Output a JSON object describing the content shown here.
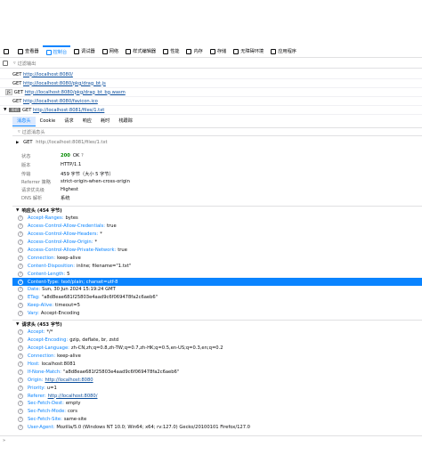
{
  "toolbar": {
    "items": [
      {
        "label": "查看器",
        "icon": "inspector-icon"
      },
      {
        "label": "控制台",
        "icon": "console-icon"
      },
      {
        "label": "调试器",
        "icon": "debugger-icon"
      },
      {
        "label": "网络",
        "icon": "network-icon"
      },
      {
        "label": "样式编辑器",
        "icon": "style-editor-icon"
      },
      {
        "label": "性能",
        "icon": "performance-icon"
      },
      {
        "label": "内存",
        "icon": "memory-icon"
      },
      {
        "label": "存储",
        "icon": "storage-icon"
      },
      {
        "label": "无障碍环境",
        "icon": "accessibility-icon"
      },
      {
        "label": "应用程序",
        "icon": "application-icon"
      }
    ],
    "active_index": 1
  },
  "console_filter": {
    "placeholder": "过滤输出"
  },
  "requests": [
    {
      "method": "GET",
      "url": "http://localhost:8080/",
      "badge": ""
    },
    {
      "method": "GET",
      "url": "http://localhost:8080/pkg/drag_bt.js",
      "badge": ""
    },
    {
      "method": "GET",
      "url": "http://localhost:8080/pkg/drag_bt_bg.wasm",
      "badge": "JS"
    },
    {
      "method": "GET",
      "url": "http://localhost:8080/favicon.ico",
      "badge": ""
    },
    {
      "method": "GET",
      "url": "http://localhost:8081/files/1.txt",
      "badge": "XHR"
    }
  ],
  "detail_tabs": [
    "消息头",
    "Cookie",
    "请求",
    "响应",
    "耗时",
    "栈跟踪"
  ],
  "detail_filter": {
    "placeholder": "过滤消息头"
  },
  "summary": {
    "method": "GET",
    "url": "http://localhost:8081/files/1.txt"
  },
  "general": [
    {
      "k": "状态",
      "v": "OK",
      "code": "200"
    },
    {
      "k": "版本",
      "v": "HTTP/1.1"
    },
    {
      "k": "传输",
      "v": "459 字节（大小 5 字节）"
    },
    {
      "k": "Referrer 策略",
      "v": "strict-origin-when-cross-origin"
    },
    {
      "k": "请求优先级",
      "v": "Highest"
    },
    {
      "k": "DNS 解析",
      "v": "系统"
    }
  ],
  "response_headers": {
    "title": "响应头 (454 字节)",
    "rows": [
      {
        "n": "Accept-Ranges:",
        "v": "bytes"
      },
      {
        "n": "Access-Control-Allow-Credentials:",
        "v": "true"
      },
      {
        "n": "Access-Control-Allow-Headers:",
        "v": "*"
      },
      {
        "n": "Access-Control-Allow-Origin:",
        "v": "*"
      },
      {
        "n": "Access-Control-Allow-Private-Network:",
        "v": "true"
      },
      {
        "n": "Connection:",
        "v": "keep-alive"
      },
      {
        "n": "Content-Disposition:",
        "v": "inline; filename=\"1.txt\""
      },
      {
        "n": "Content-Length:",
        "v": "5"
      },
      {
        "n": "Content-Type:",
        "v": "text/plain; charset=utf-8",
        "selected": true
      },
      {
        "n": "Date:",
        "v": "Sun, 30 Jun 2024 15:19:24 GMT"
      },
      {
        "n": "ETag:",
        "v": "\"a8d8eae681f25803e4aad9c6f069478fa2c6aeb6\""
      },
      {
        "n": "Keep-Alive:",
        "v": "timeout=5"
      },
      {
        "n": "Vary:",
        "v": "Accept-Encoding"
      }
    ]
  },
  "request_headers": {
    "title": "请求头 (453 字节)",
    "rows": [
      {
        "n": "Accept:",
        "v": "*/*"
      },
      {
        "n": "Accept-Encoding:",
        "v": "gzip, deflate, br, zstd"
      },
      {
        "n": "Accept-Language:",
        "v": "zh-CN,zh;q=0.8,zh-TW;q=0.7,zh-HK;q=0.5,en-US;q=0.3,en;q=0.2"
      },
      {
        "n": "Connection:",
        "v": "keep-alive"
      },
      {
        "n": "Host:",
        "v": "localhost:8081"
      },
      {
        "n": "If-None-Match:",
        "v": "\"a8d8eae681f25803e4aad9c6f069478fa2c6aeb6\""
      },
      {
        "n": "Origin:",
        "v": "http://localhost:8080",
        "link": true
      },
      {
        "n": "Priority:",
        "v": "u=1"
      },
      {
        "n": "Referer:",
        "v": "http://localhost:8080/",
        "link": true
      },
      {
        "n": "Sec-Fetch-Dest:",
        "v": "empty"
      },
      {
        "n": "Sec-Fetch-Mode:",
        "v": "cors"
      },
      {
        "n": "Sec-Fetch-Site:",
        "v": "same-site"
      },
      {
        "n": "User-Agent:",
        "v": "Mozilla/5.0 (Windows NT 10.0; Win64; x64; rv:127.0) Gecko/20100101 Firefox/127.0"
      }
    ]
  },
  "bottom": {
    "prompt": "»"
  },
  "colors": {
    "accent": "#0a84ff",
    "ok": "#058b00",
    "link": "#0a4d9c"
  }
}
